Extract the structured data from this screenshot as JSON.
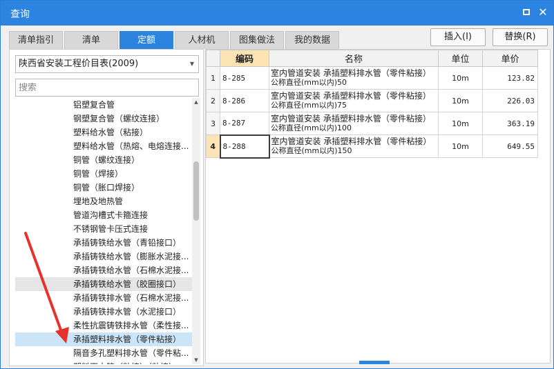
{
  "window": {
    "title": "查询"
  },
  "tabs": [
    {
      "label": "清单指引",
      "active": false
    },
    {
      "label": "清单",
      "active": false
    },
    {
      "label": "定额",
      "active": true
    },
    {
      "label": "人材机",
      "active": false
    },
    {
      "label": "图集做法",
      "active": false
    },
    {
      "label": "我的数据",
      "active": false
    }
  ],
  "actions": {
    "insert_label": "插入(I)",
    "replace_label": "替换(R)"
  },
  "left": {
    "library_select": "陕西省安装工程价目表(2009)",
    "search_placeholder": "搜索",
    "tree_items": [
      "铝塑复合管",
      "钢塑复合管（螺纹连接）",
      "塑料给水管（粘接）",
      "塑料给水管（热熔、电熔连接...",
      "铜管（螺纹连接）",
      "铜管（焊接）",
      "铜管（胀口焊接）",
      "埋地及地热管",
      "管道沟槽式卡箍连接",
      "不锈钢管卡压式连接",
      "承插铸铁给水管（青铅接口）",
      "承插铸铁给水管（膨胀水泥接...",
      "承插铸铁给水管（石棉水泥接...",
      "承插铸铁给水管（胶圈接口）",
      "承插铸铁排水管（石棉水泥接...",
      "承插铸铁排水管（水泥接口）",
      "柔性抗震铸铁排水管（柔性接...",
      "承插塑料排水管（零件粘接）",
      "隔音多孔塑料排水管（零件粘...",
      "塑料雨水管（粘接）（粘接）"
    ],
    "hover_index": 13,
    "selected_index": 17
  },
  "grid": {
    "columns": [
      "编码",
      "名称",
      "单位",
      "单价"
    ],
    "rows": [
      {
        "n": "1",
        "code": "8-285",
        "name1": "室内管道安装 承插塑料排水管（零件粘接）",
        "name2": "公称直径(mm以内)50",
        "unit": "10m",
        "price": "123.82"
      },
      {
        "n": "2",
        "code": "8-286",
        "name1": "室内管道安装 承插塑料排水管（零件粘接）",
        "name2": "公称直径(mm以内)75",
        "unit": "10m",
        "price": "226.03"
      },
      {
        "n": "3",
        "code": "8-287",
        "name1": "室内管道安装 承插塑料排水管（零件粘接）",
        "name2": "公称直径(mm以内)100",
        "unit": "10m",
        "price": "363.19"
      },
      {
        "n": "4",
        "code": "8-288",
        "name1": "室内管道安装 承插塑料排水管（零件粘接）",
        "name2": "公称直径(mm以内)150",
        "unit": "10m",
        "price": "649.55"
      }
    ],
    "active_row": 3
  },
  "colors": {
    "accent": "#2c84e0",
    "annotation_arrow": "#e8312a",
    "selected": "#cce4f7",
    "header_highlight": "#fbe3b3"
  }
}
